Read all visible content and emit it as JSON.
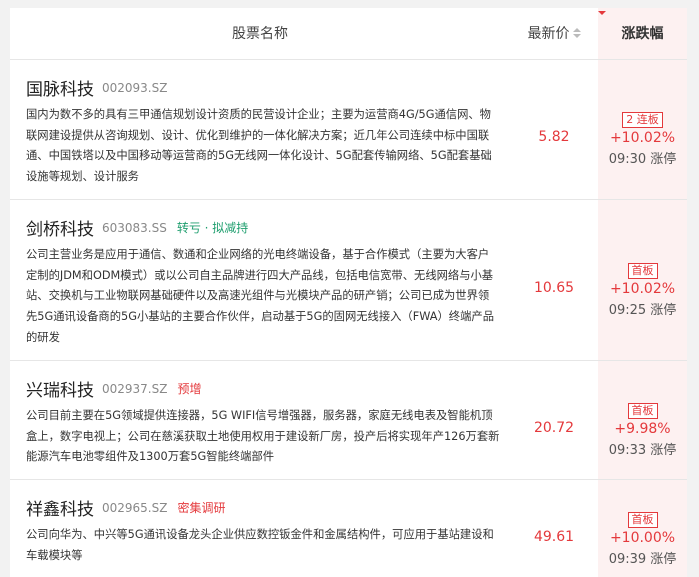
{
  "header": {
    "name_label": "股票名称",
    "price_label": "最新价",
    "change_label": "涨跌幅"
  },
  "stocks": [
    {
      "name": "国脉科技",
      "code": "002093.SZ",
      "tag": "",
      "desc": "国内为数不多的具有三甲通信规划设计资质的民营设计企业；主要为运营商4G/5G通信网、物联网建设提供从咨询规划、设计、优化到维护的一体化解决方案；近几年公司连续中标中国联通、中国铁塔以及中国移动等运营商的5G无线网一体化设计、5G配套传输网络、5G配套基础设施等规划、设计服务",
      "price": "5.82",
      "badge": "2 连板",
      "change": "+10.02%",
      "limit_time": "09:30 涨停"
    },
    {
      "name": "剑桥科技",
      "code": "603083.SS",
      "tag": "转亏 · 拟减持",
      "desc": "公司主营业务是应用于通信、数通和企业网络的光电终端设备，基于合作模式（主要为大客户定制的JDM和ODM模式）或以公司自主品牌进行四大产品线，包括电信宽带、无线网络与小基站、交换机与工业物联网基础硬件以及高速光组件与光模块产品的研产销；公司已成为世界领先5G通讯设备商的5G小基站的主要合作伙伴，启动基于5G的固网无线接入（FWA）终端产品的研发",
      "price": "10.65",
      "badge": "首板",
      "change": "+10.02%",
      "limit_time": "09:25 涨停"
    },
    {
      "name": "兴瑞科技",
      "code": "002937.SZ",
      "tag": "预增",
      "desc": "公司目前主要在5G领域提供连接器，5G WIFI信号增强器，服务器，家庭无线电表及智能机顶盒上，数字电视上；公司在慈溪获取土地使用权用于建设新厂房，投产后将实现年产126万套新能源汽车电池零组件及1300万套5G智能终端部件",
      "price": "20.72",
      "badge": "首板",
      "change": "+9.98%",
      "limit_time": "09:33 涨停"
    },
    {
      "name": "祥鑫科技",
      "code": "002965.SZ",
      "tag": "密集调研",
      "desc": "公司向华为、中兴等5G通讯设备龙头企业供应数控钣金件和金属结构件，可应用于基站建设和车载模块等",
      "price": "49.61",
      "badge": "首板",
      "change": "+10.00%",
      "limit_time": "09:39 涨停"
    }
  ]
}
